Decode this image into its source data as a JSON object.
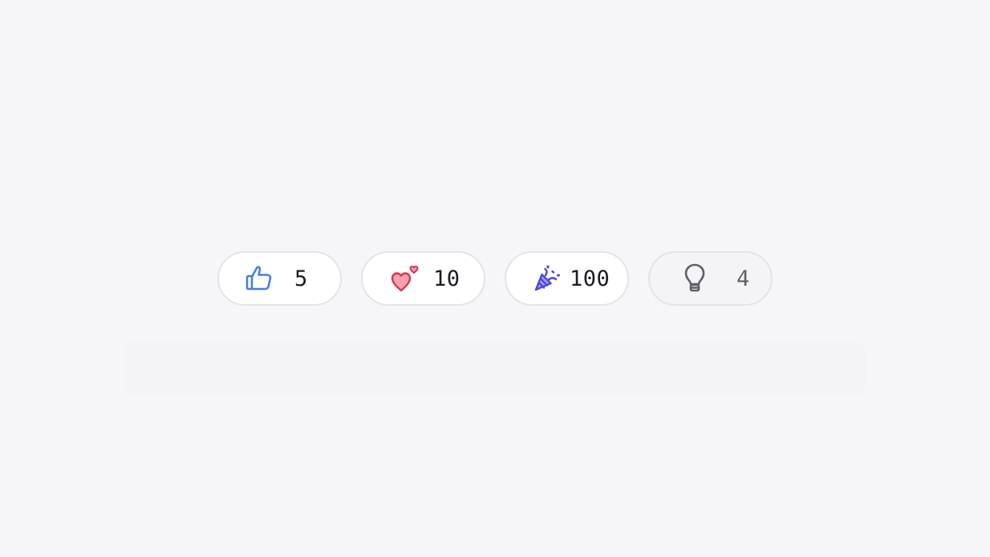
{
  "reactions": [
    {
      "icon": "thumbs-up-icon",
      "count": "5",
      "color": "#4a7ee0",
      "active": true
    },
    {
      "icon": "heart-icon",
      "count": "10",
      "color": "#e0455b",
      "active": true
    },
    {
      "icon": "party-popper-icon",
      "count": "100",
      "color": "#4f46e5",
      "active": true
    },
    {
      "icon": "lightbulb-icon",
      "count": "4",
      "color": "#5f5f69",
      "active": false
    }
  ]
}
